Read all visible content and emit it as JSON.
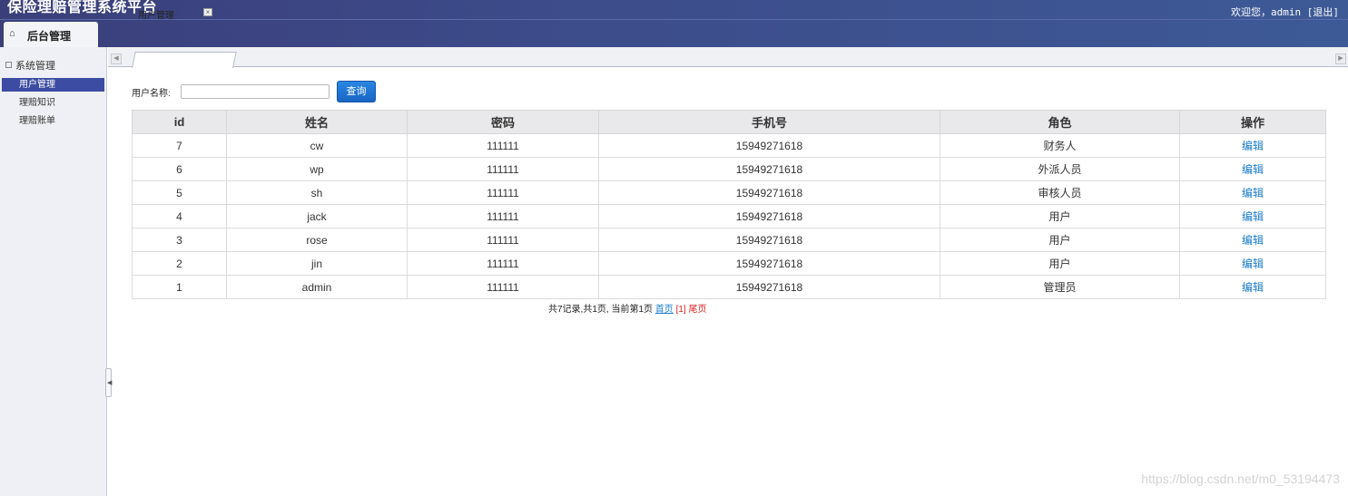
{
  "header": {
    "title": "保险理赔管理系统平台",
    "welcome": "欢迎您，admin [退出]",
    "home_tab": "后台管理"
  },
  "sidebar": {
    "group": "系统管理",
    "items": [
      {
        "label": "用户管理"
      },
      {
        "label": "理赔知识"
      },
      {
        "label": "理赔账单"
      }
    ]
  },
  "tabs": [
    {
      "label": "用户管理",
      "close": "×"
    }
  ],
  "search": {
    "label": "用户名称:",
    "value": "",
    "placeholder": "",
    "button": "查询"
  },
  "table": {
    "columns": [
      "id",
      "姓名",
      "密码",
      "手机号",
      "角色",
      "操作"
    ],
    "rows": [
      {
        "id": "7",
        "name": "cw",
        "password": "111111",
        "phone": "15949271618",
        "role": "财务人",
        "action": "编辑"
      },
      {
        "id": "6",
        "name": "wp",
        "password": "111111",
        "phone": "15949271618",
        "role": "外派人员",
        "action": "编辑"
      },
      {
        "id": "5",
        "name": "sh",
        "password": "111111",
        "phone": "15949271618",
        "role": "审核人员",
        "action": "编辑"
      },
      {
        "id": "4",
        "name": "jack",
        "password": "111111",
        "phone": "15949271618",
        "role": "用户",
        "action": "编辑"
      },
      {
        "id": "3",
        "name": "rose",
        "password": "111111",
        "phone": "15949271618",
        "role": "用户",
        "action": "编辑"
      },
      {
        "id": "2",
        "name": "jin",
        "password": "111111",
        "phone": "15949271618",
        "role": "用户",
        "action": "编辑"
      },
      {
        "id": "1",
        "name": "admin",
        "password": "111111",
        "phone": "15949271618",
        "role": "管理员",
        "action": "编辑"
      }
    ]
  },
  "pager": {
    "summary": "共7记录,共1页, 当前第1页",
    "first": "首页",
    "current": "[1]",
    "last": "尾页"
  },
  "watermark": "https://blog.csdn.net/m0_53194473"
}
